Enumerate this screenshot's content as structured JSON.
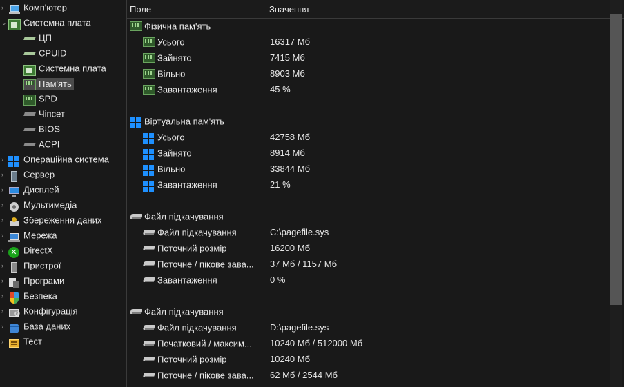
{
  "tree": {
    "items": [
      {
        "label": "Комп'ютер",
        "icon": "computer-icon",
        "level": 0,
        "expander": "›"
      },
      {
        "label": "Системна плата",
        "icon": "motherboard-icon",
        "level": 0,
        "expander": "⌄"
      },
      {
        "label": "ЦП",
        "icon": "cpu-icon",
        "level": 1
      },
      {
        "label": "CPUID",
        "icon": "cpuid-icon",
        "level": 1
      },
      {
        "label": "Системна плата",
        "icon": "motherboard-icon",
        "level": 1
      },
      {
        "label": "Пам'ять",
        "icon": "memory-icon",
        "level": 1,
        "selected": true
      },
      {
        "label": "SPD",
        "icon": "memory-icon",
        "level": 1
      },
      {
        "label": "Чіпсет",
        "icon": "chipset-icon",
        "level": 1
      },
      {
        "label": "BIOS",
        "icon": "bios-icon",
        "level": 1
      },
      {
        "label": "ACPI",
        "icon": "acpi-icon",
        "level": 1
      },
      {
        "label": "Операційна система",
        "icon": "windows-icon",
        "level": 0,
        "expander": "›"
      },
      {
        "label": "Сервер",
        "icon": "server-icon",
        "level": 0,
        "expander": "›"
      },
      {
        "label": "Дисплей",
        "icon": "display-icon",
        "level": 0,
        "expander": "›"
      },
      {
        "label": "Мультимедіа",
        "icon": "multimedia-icon",
        "level": 0,
        "expander": "›"
      },
      {
        "label": "Збереження даних",
        "icon": "storage-icon",
        "level": 0,
        "expander": "›"
      },
      {
        "label": "Мережа",
        "icon": "network-icon",
        "level": 0,
        "expander": "›"
      },
      {
        "label": "DirectX",
        "icon": "directx-icon",
        "level": 0,
        "expander": "›"
      },
      {
        "label": "Пристрої",
        "icon": "devices-icon",
        "level": 0,
        "expander": "›"
      },
      {
        "label": "Програми",
        "icon": "programs-icon",
        "level": 0,
        "expander": "›"
      },
      {
        "label": "Безпека",
        "icon": "security-icon",
        "level": 0,
        "expander": "›"
      },
      {
        "label": "Конфігурація",
        "icon": "config-icon",
        "level": 0,
        "expander": "›"
      },
      {
        "label": "База даних",
        "icon": "database-icon",
        "level": 0,
        "expander": "›"
      },
      {
        "label": "Тест",
        "icon": "benchmark-icon",
        "level": 0,
        "expander": "›"
      }
    ]
  },
  "header": {
    "col_field": "Поле",
    "col_value": "Значення"
  },
  "rows": [
    {
      "type": "group",
      "icon": "memory-icon",
      "field": "Фізична пам'ять",
      "value": ""
    },
    {
      "type": "item",
      "icon": "memory-icon",
      "field": "Усього",
      "value": "16317 Мб"
    },
    {
      "type": "item",
      "icon": "memory-icon",
      "field": "Зайнято",
      "value": "7415 Мб"
    },
    {
      "type": "item",
      "icon": "memory-icon",
      "field": "Вільно",
      "value": "8903 Мб"
    },
    {
      "type": "item",
      "icon": "memory-icon",
      "field": "Завантаження",
      "value": "45 %"
    },
    {
      "type": "spacer"
    },
    {
      "type": "group",
      "icon": "windows-icon",
      "field": "Віртуальна пам'ять",
      "value": ""
    },
    {
      "type": "item",
      "icon": "windows-icon",
      "field": "Усього",
      "value": "42758 Мб"
    },
    {
      "type": "item",
      "icon": "windows-icon",
      "field": "Зайнято",
      "value": "8914 Мб"
    },
    {
      "type": "item",
      "icon": "windows-icon",
      "field": "Вільно",
      "value": "33844 Мб"
    },
    {
      "type": "item",
      "icon": "windows-icon",
      "field": "Завантаження",
      "value": "21 %"
    },
    {
      "type": "spacer"
    },
    {
      "type": "group",
      "icon": "drive-icon",
      "field": "Файл підкачування",
      "value": ""
    },
    {
      "type": "item",
      "icon": "drive-icon",
      "field": "Файл підкачування",
      "value": "C:\\pagefile.sys"
    },
    {
      "type": "item",
      "icon": "drive-icon",
      "field": "Поточний розмір",
      "value": "16200 Мб"
    },
    {
      "type": "item",
      "icon": "drive-icon",
      "field": "Поточне / пікове зава...",
      "value": "37 Мб / 1157 Мб"
    },
    {
      "type": "item",
      "icon": "drive-icon",
      "field": "Завантаження",
      "value": "0 %"
    },
    {
      "type": "spacer"
    },
    {
      "type": "group",
      "icon": "drive-icon",
      "field": "Файл підкачування",
      "value": ""
    },
    {
      "type": "item",
      "icon": "drive-icon",
      "field": "Файл підкачування",
      "value": "D:\\pagefile.sys"
    },
    {
      "type": "item",
      "icon": "drive-icon",
      "field": "Початковий / максим...",
      "value": "10240 Мб / 512000 Мб"
    },
    {
      "type": "item",
      "icon": "drive-icon",
      "field": "Поточний розмір",
      "value": "10240 Мб"
    },
    {
      "type": "item",
      "icon": "drive-icon",
      "field": "Поточне / пікове зава...",
      "value": "62 Мб / 2544 Мб"
    }
  ]
}
